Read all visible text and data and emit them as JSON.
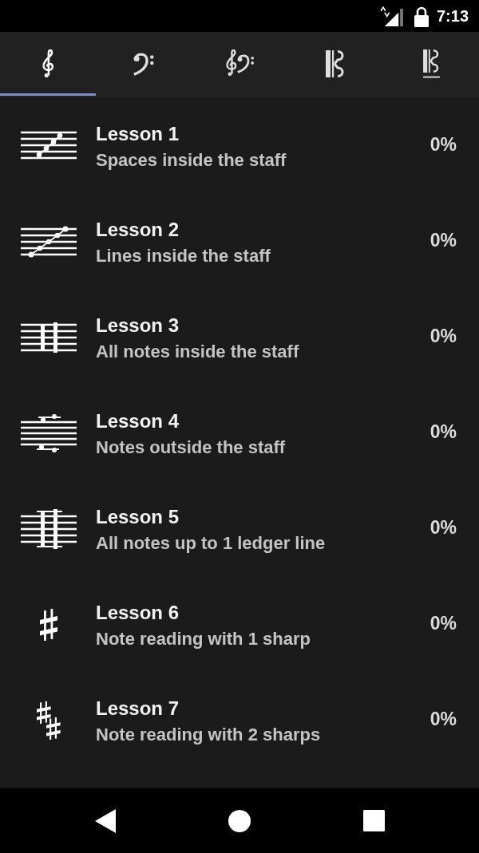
{
  "status_bar": {
    "time": "7:13"
  },
  "tabs": [
    {
      "kind": "treble",
      "selected": true
    },
    {
      "kind": "bass",
      "selected": false
    },
    {
      "kind": "grand",
      "selected": false
    },
    {
      "kind": "alto",
      "selected": false
    },
    {
      "kind": "tenor",
      "selected": false
    }
  ],
  "lessons": [
    {
      "kind": "spaces",
      "title": "Lesson 1",
      "subtitle": "Spaces inside the staff",
      "percent": "0%"
    },
    {
      "kind": "lines",
      "title": "Lesson 2",
      "subtitle": "Lines inside the staff",
      "percent": "0%"
    },
    {
      "kind": "inside",
      "title": "Lesson 3",
      "subtitle": "All notes inside the staff",
      "percent": "0%"
    },
    {
      "kind": "outside",
      "title": "Lesson 4",
      "subtitle": "Notes outside the staff",
      "percent": "0%"
    },
    {
      "kind": "ledger",
      "title": "Lesson 5",
      "subtitle": "All notes up to 1 ledger line",
      "percent": "0%"
    },
    {
      "kind": "sharp",
      "title": "Lesson 6",
      "subtitle": "Note reading with 1 sharp",
      "percent": "0%"
    },
    {
      "kind": "two-sharps",
      "title": "Lesson 7",
      "subtitle": "Note reading with 2 sharps",
      "percent": "0%"
    }
  ]
}
